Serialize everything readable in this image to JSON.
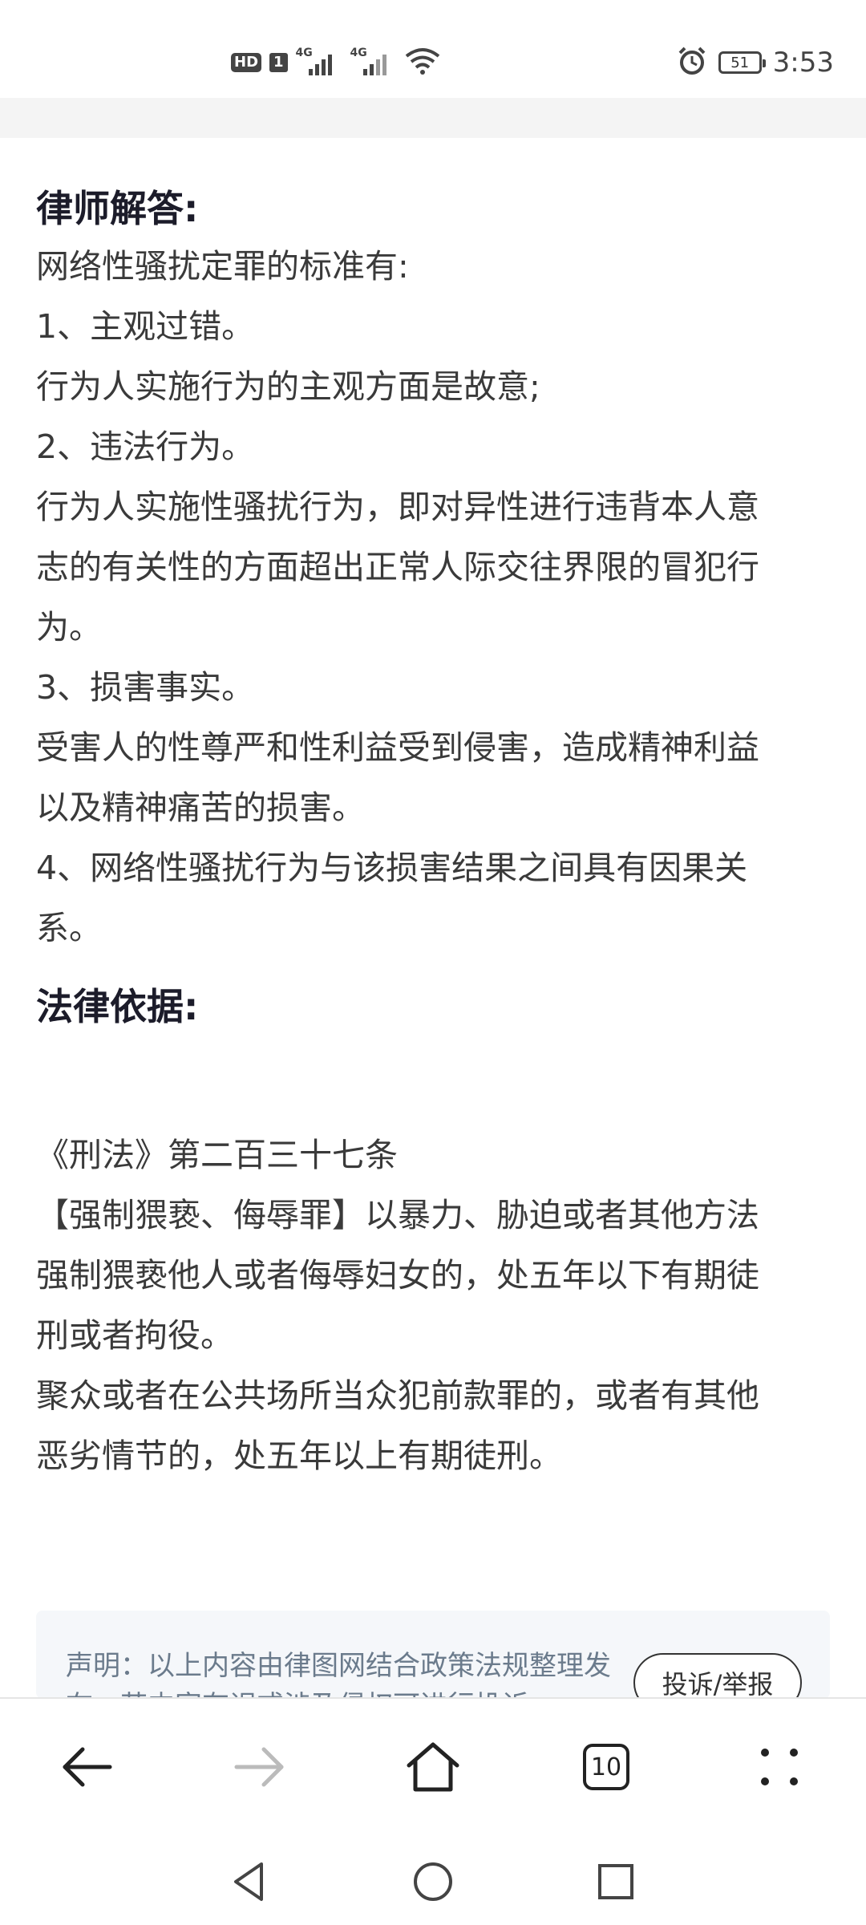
{
  "status_bar": {
    "hd": "HD",
    "sim": "1",
    "net1": "4G",
    "net2": "4G",
    "battery": "51",
    "time": "3:53",
    "icons": [
      "signal-icon",
      "wifi-icon",
      "alarm-icon",
      "battery-icon"
    ]
  },
  "article": {
    "answer_heading": "律师解答:",
    "answer_lines": [
      "网络性骚扰定罪的标准有:",
      "1、主观过错。",
      "行为人实施行为的主观方面是故意;",
      "2、违法行为。",
      "行为人实施性骚扰行为，即对异性进行违背本人意",
      "志的有关性的方面超出正常人际交往界限的冒犯行",
      "为。",
      "3、损害事实。",
      "受害人的性尊严和性利益受到侵害，造成精神利益",
      "以及精神痛苦的损害。",
      "4、网络性骚扰行为与该损害结果之间具有因果关",
      "系。"
    ],
    "law_heading": "法律依据:",
    "law_lines": [
      "《刑法》第二百三十七条",
      "【强制猥亵、侮辱罪】以暴力、胁迫或者其他方法",
      "强制猥亵他人或者侮辱妇女的，处五年以下有期徒",
      "刑或者拘役。",
      "聚众或者在公共场所当众犯前款罪的，或者有其他",
      "恶劣情节的，处五年以上有期徒刑。"
    ]
  },
  "disclaimer": {
    "text": "声明：以上内容由律图网结合政策法规整理发布，若内容有误或涉及侵权可进行投诉",
    "report_button": "投诉/举报"
  },
  "toolbar": {
    "tabs_count": "10",
    "icons": [
      "back-icon",
      "forward-icon",
      "home-icon",
      "tabs-icon",
      "menu-icon"
    ]
  },
  "system_nav": {
    "icons": [
      "nav-back-icon",
      "nav-home-icon",
      "nav-recents-icon"
    ]
  },
  "colors": {
    "heading": "#1c1c2a",
    "body_text": "#3a3a3a",
    "disclaimer_bg": "#f5f7fa",
    "disclaimer_text": "#6b7b8c",
    "disabled_icon": "#bbbbbb"
  }
}
